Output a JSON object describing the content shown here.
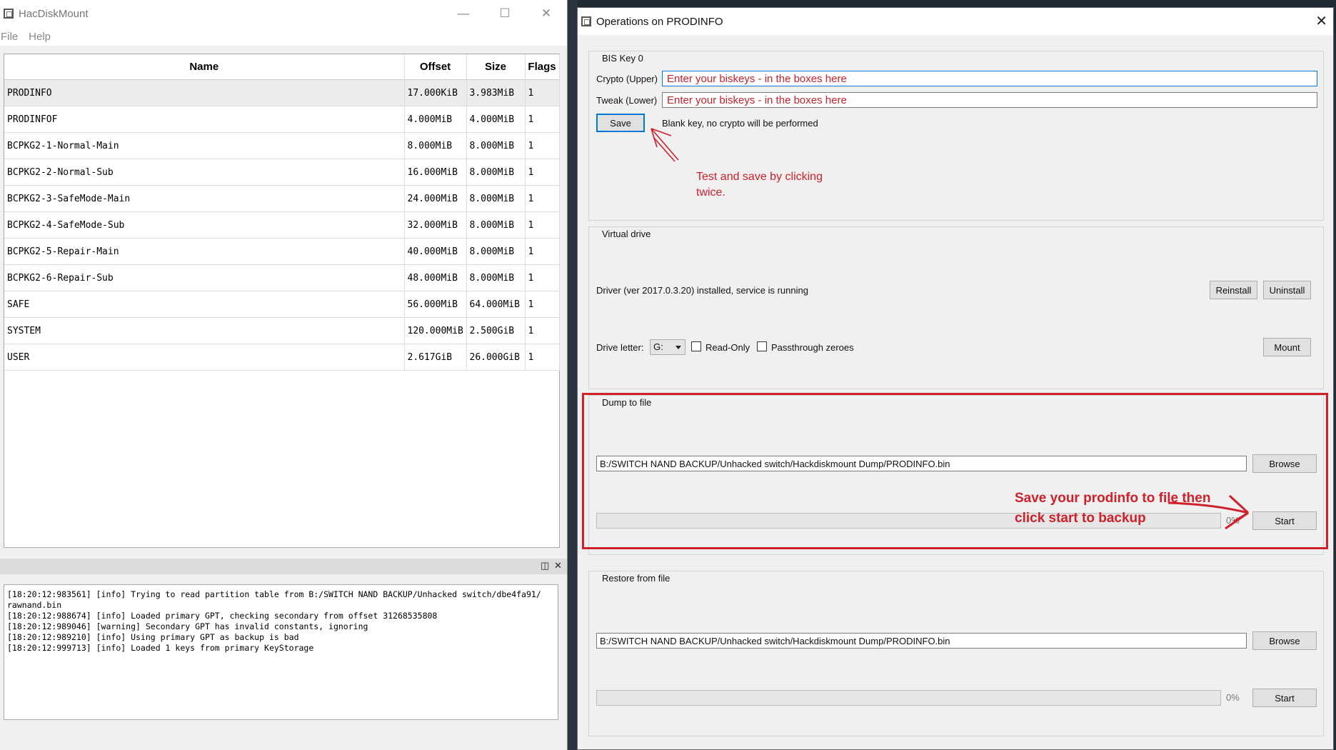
{
  "main_window": {
    "title": "HacDiskMount",
    "menu": [
      "File",
      "Help"
    ],
    "columns": [
      "Name",
      "Offset",
      "Size",
      "Flags"
    ],
    "rows": [
      {
        "name": "PRODINFO",
        "offset": "17.000KiB",
        "size": "3.983MiB",
        "flags": "1"
      },
      {
        "name": "PRODINFOF",
        "offset": "4.000MiB",
        "size": "4.000MiB",
        "flags": "1"
      },
      {
        "name": "BCPKG2-1-Normal-Main",
        "offset": "8.000MiB",
        "size": "8.000MiB",
        "flags": "1"
      },
      {
        "name": "BCPKG2-2-Normal-Sub",
        "offset": "16.000MiB",
        "size": "8.000MiB",
        "flags": "1"
      },
      {
        "name": "BCPKG2-3-SafeMode-Main",
        "offset": "24.000MiB",
        "size": "8.000MiB",
        "flags": "1"
      },
      {
        "name": "BCPKG2-4-SafeMode-Sub",
        "offset": "32.000MiB",
        "size": "8.000MiB",
        "flags": "1"
      },
      {
        "name": "BCPKG2-5-Repair-Main",
        "offset": "40.000MiB",
        "size": "8.000MiB",
        "flags": "1"
      },
      {
        "name": "BCPKG2-6-Repair-Sub",
        "offset": "48.000MiB",
        "size": "8.000MiB",
        "flags": "1"
      },
      {
        "name": "SAFE",
        "offset": "56.000MiB",
        "size": "64.000MiB",
        "flags": "1"
      },
      {
        "name": "SYSTEM",
        "offset": "120.000MiB",
        "size": "2.500GiB",
        "flags": "1"
      },
      {
        "name": "USER",
        "offset": "2.617GiB",
        "size": "26.000GiB",
        "flags": "1"
      }
    ],
    "log_lines": [
      "[18:20:12:983561] [info] Trying to read partition table from B:/SWITCH NAND BACKUP/Unhacked switch/dbe4fa91/",
      "rawnand.bin",
      "[18:20:12:988674] [info] Loaded primary GPT, checking secondary from offset 31268535808",
      "[18:20:12:989046] [warning] Secondary GPT has invalid constants, ignoring",
      "[18:20:12:989210] [info] Using primary GPT as backup is bad",
      "[18:20:12:999713] [info] Loaded 1 keys from primary KeyStorage"
    ]
  },
  "dialog": {
    "title": "Operations on PRODINFO",
    "bis_key": {
      "group_title": "BIS Key 0",
      "crypto_label": "Crypto (Upper)",
      "crypto_value": "Enter your biskeys - in the boxes here",
      "tweak_label": "Tweak (Lower)",
      "tweak_value": "Enter your biskeys - in the boxes here",
      "save_label": "Save",
      "status": "Blank key, no crypto will be performed",
      "annotation_line1": "Test and save by clicking",
      "annotation_line2": "twice."
    },
    "virtual_drive": {
      "group_title": "Virtual drive",
      "driver_status": "Driver (ver 2017.0.3.20) installed, service is running",
      "reinstall_label": "Reinstall",
      "uninstall_label": "Uninstall",
      "drive_letter_label": "Drive letter:",
      "drive_letter_value": "G:",
      "readonly_label": "Read-Only",
      "passthrough_label": "Passthrough zeroes",
      "mount_label": "Mount"
    },
    "dump": {
      "group_title": "Dump to file",
      "path": "B:/SWITCH NAND BACKUP/Unhacked switch/Hackdiskmount Dump/PRODINFO.bin",
      "browse_label": "Browse",
      "progress_text": "0%",
      "progress_value": 0,
      "start_label": "Start",
      "annotation_line1": "Save your prodinfo to file  then",
      "annotation_line2": "click start to backup"
    },
    "restore": {
      "group_title": "Restore from file",
      "path": "B:/SWITCH NAND BACKUP/Unhacked switch/Hackdiskmount Dump/PRODINFO.bin",
      "browse_label": "Browse",
      "progress_text": "0%",
      "progress_value": 0,
      "start_label": "Start"
    }
  },
  "colors": {
    "annotation_red": "#d0202a",
    "focus_blue": "#0078d7"
  }
}
